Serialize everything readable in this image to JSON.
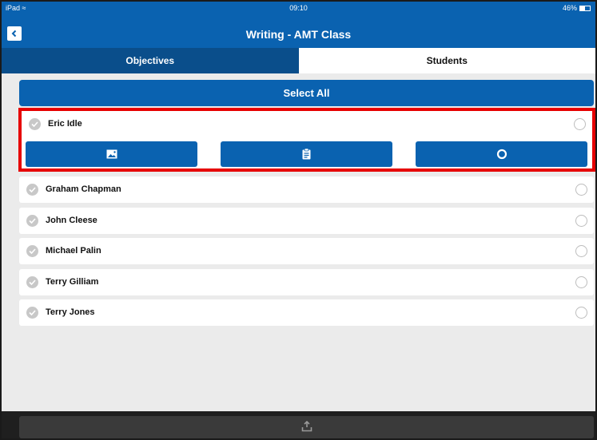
{
  "status_bar": {
    "device": "iPad",
    "time": "09:10",
    "battery": "46%"
  },
  "nav": {
    "title": "Writing - AMT Class",
    "back_icon": "chevron-left-icon"
  },
  "tabs": [
    {
      "label": "Objectives",
      "active": true
    },
    {
      "label": "Students",
      "active": false
    }
  ],
  "select_all_label": "Select All",
  "students": [
    {
      "name": "Eric Idle",
      "expanded": true
    },
    {
      "name": "Graham Chapman"
    },
    {
      "name": "John Cleese"
    },
    {
      "name": "Michael Palin"
    },
    {
      "name": "Terry Gilliam"
    },
    {
      "name": "Terry Jones"
    }
  ],
  "expanded_actions": [
    {
      "icon": "image-icon"
    },
    {
      "icon": "clipboard-icon"
    },
    {
      "icon": "circle-icon"
    }
  ],
  "bottom_bar": {
    "icon": "upload-icon"
  },
  "colors": {
    "primary": "#0a62b0",
    "tab_active": "#0a4e8b",
    "highlight": "#e60000",
    "background": "#ebebeb"
  }
}
